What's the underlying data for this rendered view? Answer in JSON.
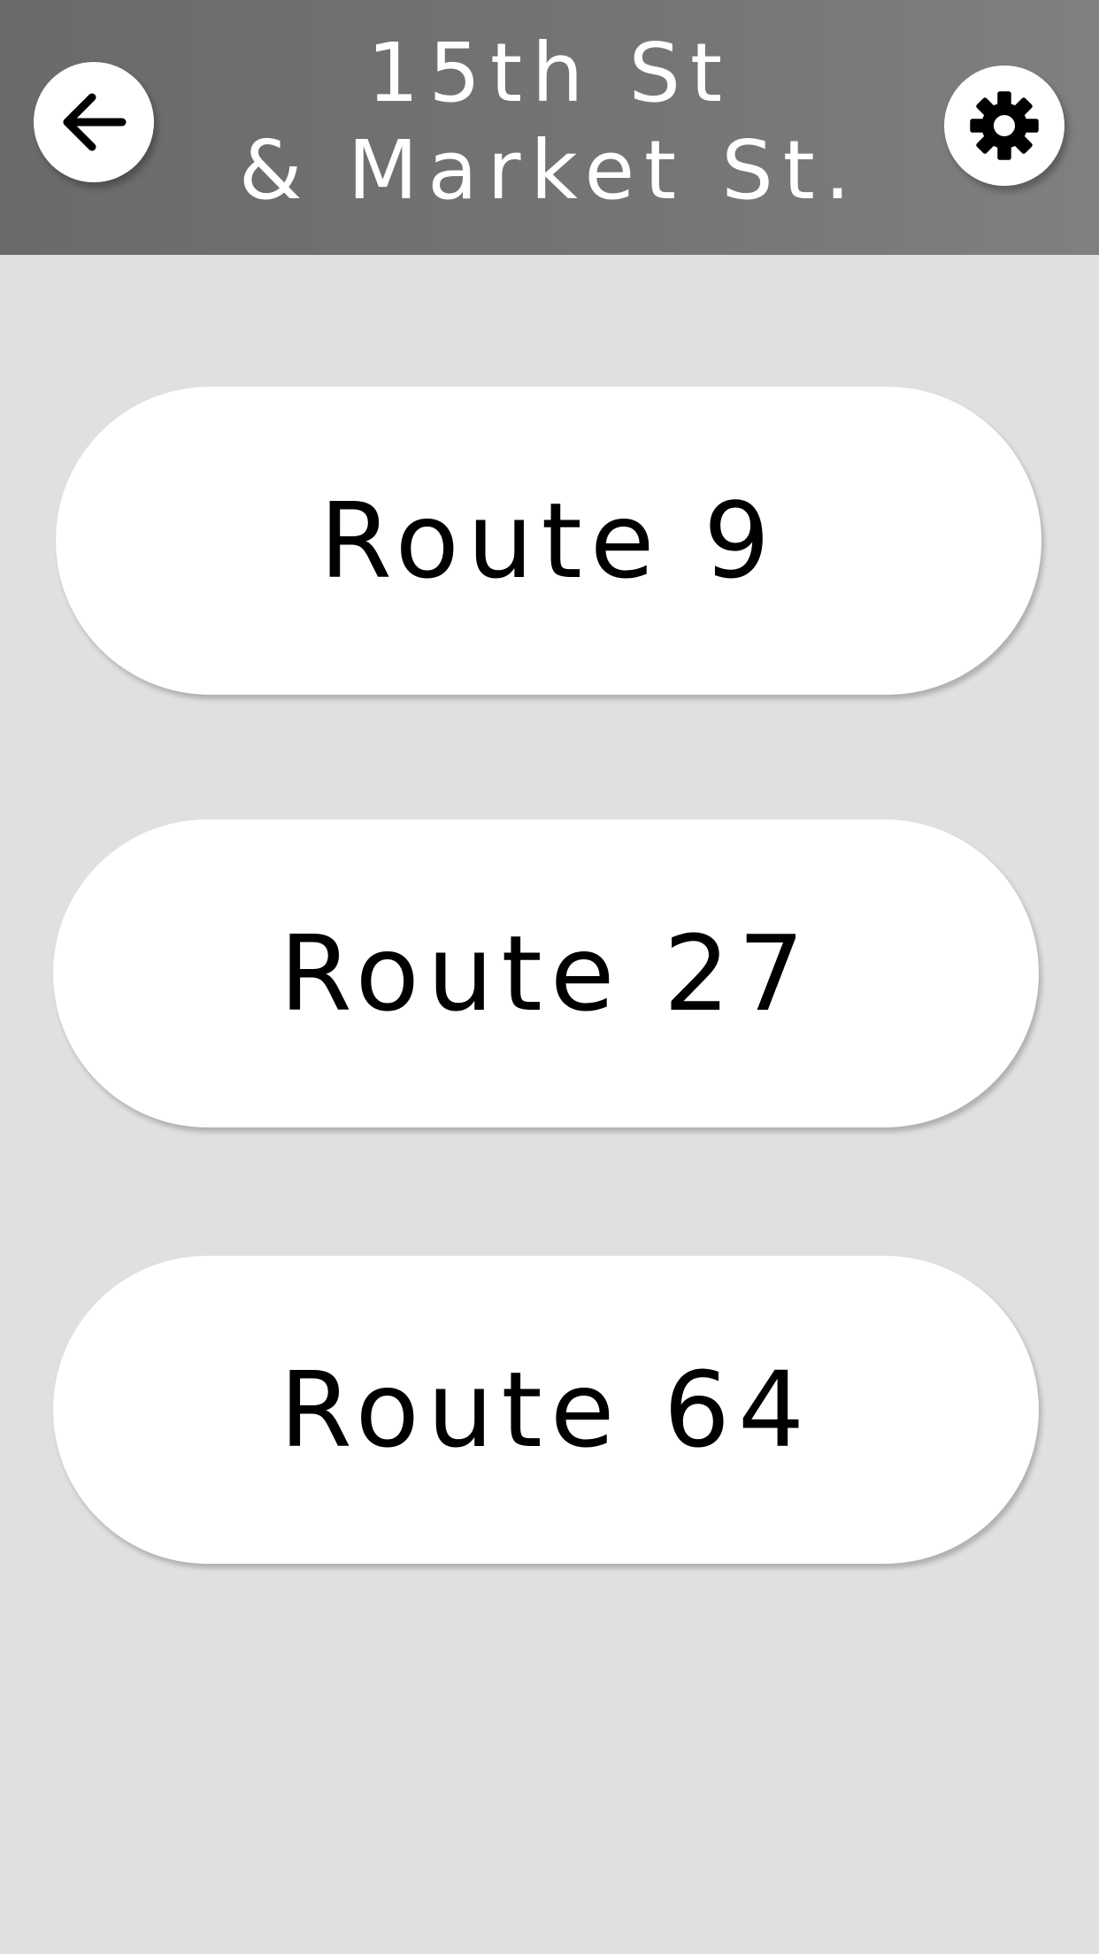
{
  "header": {
    "title_line1": "15th St",
    "title_line2": "& Market St.",
    "back_icon": "arrow-left-icon",
    "settings_icon": "gear-icon"
  },
  "routes": [
    {
      "label": "Route 9"
    },
    {
      "label": "Route 27"
    },
    {
      "label": "Route 64"
    }
  ],
  "colors": {
    "header_bg": "#757575",
    "page_bg": "#e0e0e0",
    "button_bg": "#ffffff",
    "text_dark": "#000000",
    "text_light": "#ffffff"
  }
}
